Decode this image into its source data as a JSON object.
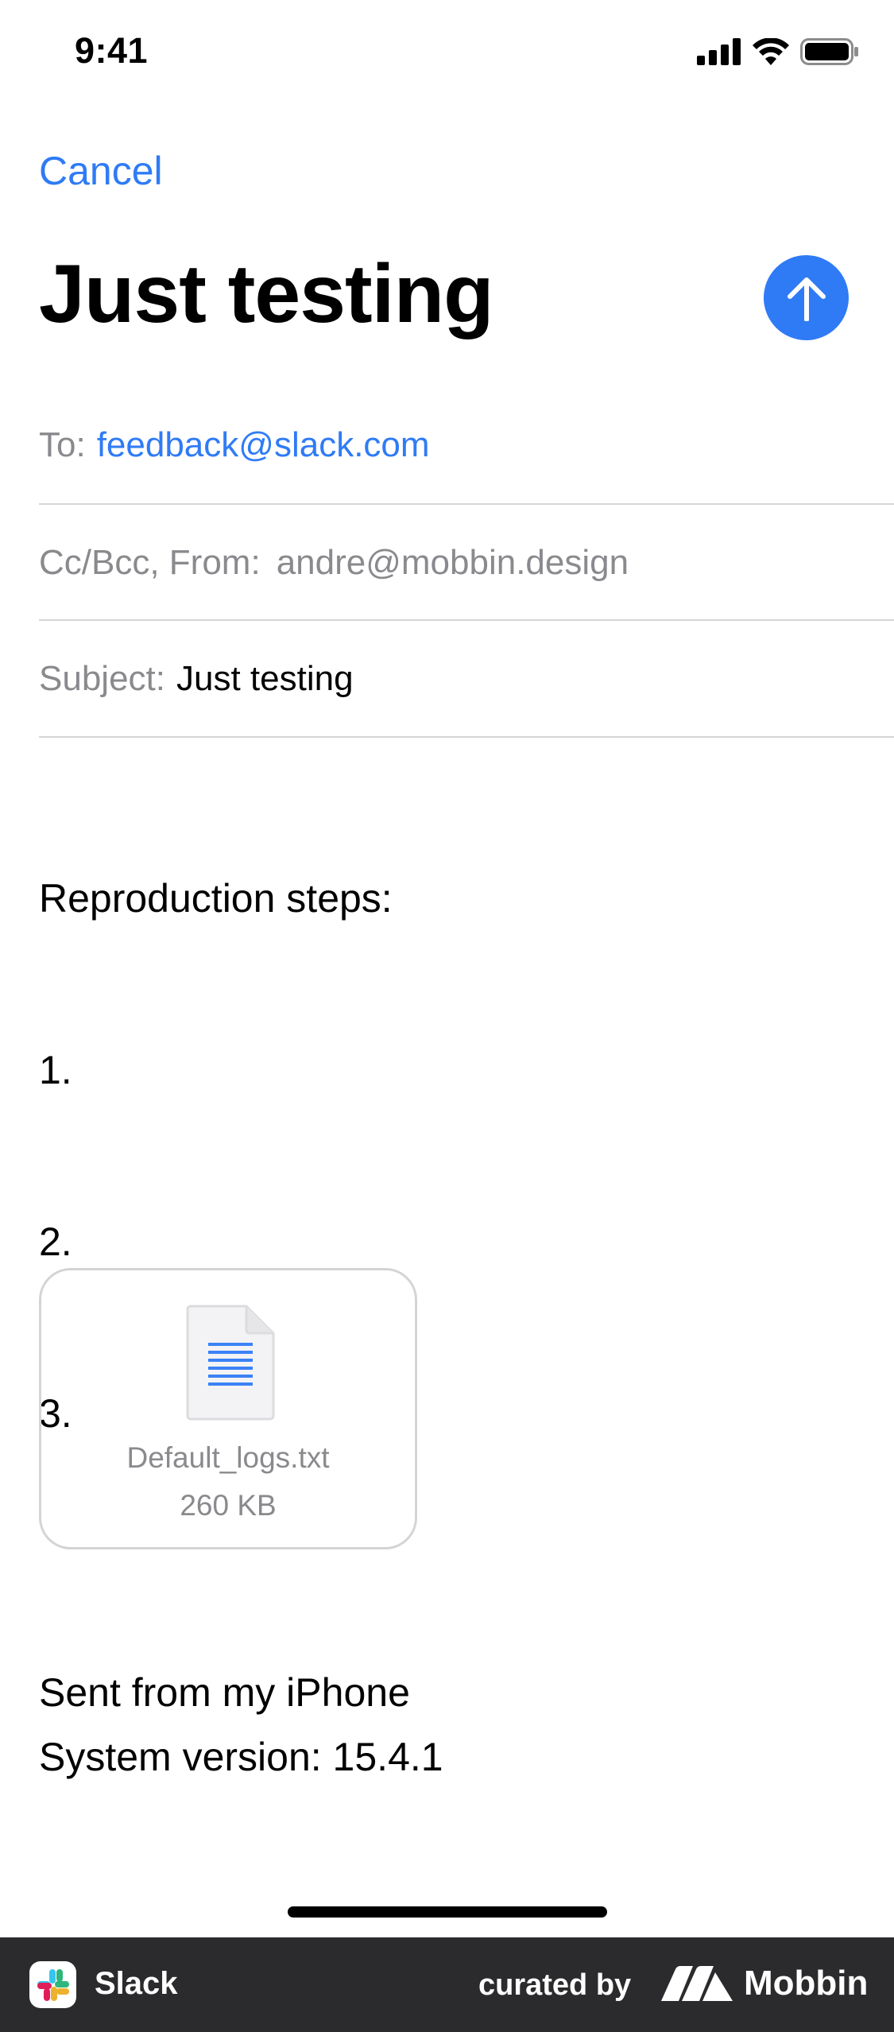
{
  "status_bar": {
    "time": "9:41",
    "icons": [
      "signal-icon",
      "wifi-icon",
      "battery-icon"
    ]
  },
  "header": {
    "cancel_label": "Cancel",
    "title": "Just testing",
    "send_icon": "arrow-up-icon"
  },
  "fields": {
    "to_label": "To:",
    "to_value": "feedback@slack.com",
    "ccbcc_label": "Cc/Bcc, From:",
    "from_value": "andre@mobbin.design",
    "subject_label": "Subject:",
    "subject_value": "Just testing"
  },
  "body": {
    "lines": [
      "Reproduction steps:",
      "1.",
      "2.",
      "3.",
      "",
      "System version: 15.4.1"
    ]
  },
  "attachment": {
    "file_name": "Default_logs.txt",
    "file_size": "260 KB",
    "icon": "text-document-icon"
  },
  "signature": "Sent from my iPhone",
  "footer": {
    "app_name": "Slack",
    "curated_label": "curated by",
    "brand_name": "Mobbin"
  },
  "colors": {
    "accent": "#2f7bf6",
    "secondary_text": "#8a8a8e",
    "footer_bg": "#2b2b2d"
  }
}
